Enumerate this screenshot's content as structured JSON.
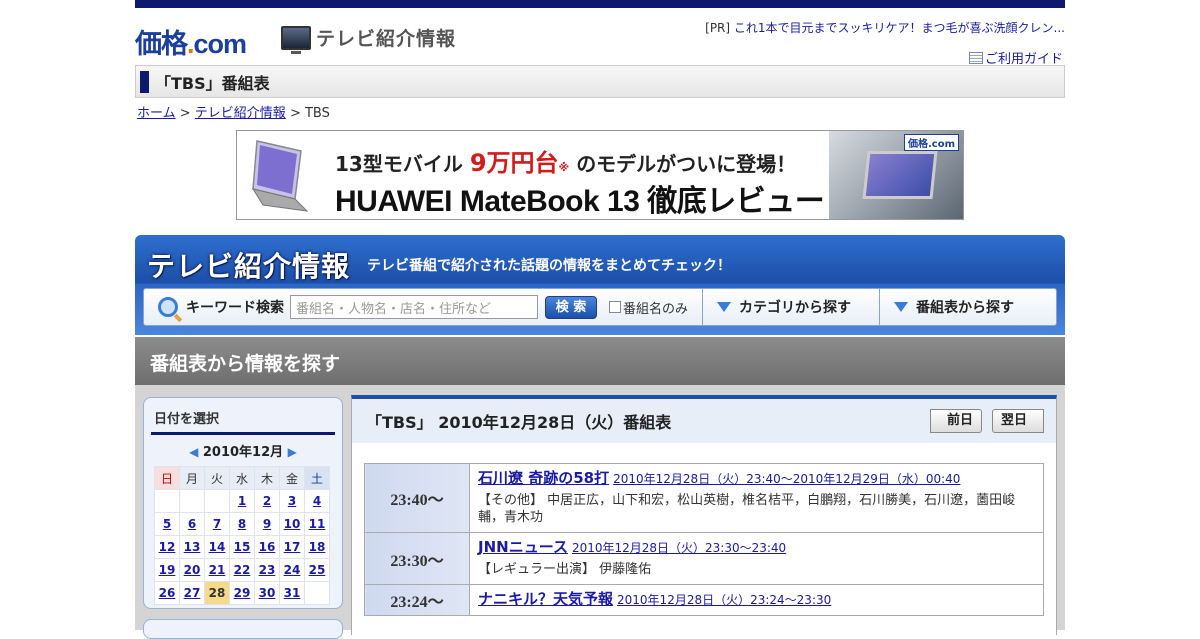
{
  "header": {
    "logo_main": "価格",
    "logo_dot": ".",
    "logo_tld": "com",
    "section_logo": "テレビ紹介情報",
    "pr_tag": "[PR]",
    "pr_text": "これ1本で目元までスッキリケア！まつ毛が喜ぶ洗顔クレン...",
    "guide": "ご利用ガイド"
  },
  "page_title": "「TBS」番組表",
  "breadcrumb": {
    "home": "ホーム",
    "sep1": " > ",
    "tv": "テレビ紹介情報",
    "sep2": " > ",
    "current": "TBS"
  },
  "ad": {
    "line1_a": "13型モバイル",
    "line1_price": "9万円台",
    "line1_mark": "※",
    "line1_b": "のモデルがついに登場！",
    "line2": "HUAWEI MateBook 13 徹底レビュー",
    "badge": "価格.com"
  },
  "search_panel": {
    "title": "テレビ紹介情報",
    "subtitle": "テレビ番組で紹介された話題の情報をまとめてチェック！",
    "keyword_label": "キーワード検索",
    "placeholder": "番組名・人物名・店名・住所など",
    "search_button": "検 索",
    "checkbox_label": "番組名のみ",
    "category_link": "カテゴリから探す",
    "schedule_link": "番組表から探す"
  },
  "section_heading": "番組表から情報を探す",
  "calendar": {
    "heading": "日付を選択",
    "month": "2010年12月",
    "weekdays": [
      "日",
      "月",
      "火",
      "水",
      "木",
      "金",
      "土"
    ],
    "weeks": [
      [
        "",
        "",
        "",
        "1",
        "2",
        "3",
        "4"
      ],
      [
        "5",
        "6",
        "7",
        "8",
        "9",
        "10",
        "11"
      ],
      [
        "12",
        "13",
        "14",
        "15",
        "16",
        "17",
        "18"
      ],
      [
        "19",
        "20",
        "21",
        "22",
        "23",
        "24",
        "25"
      ],
      [
        "26",
        "27",
        "28",
        "29",
        "30",
        "31",
        ""
      ]
    ],
    "selected": "28"
  },
  "schedule": {
    "title": "「TBS」 2010年12月28日（火）番組表",
    "prev": "前日",
    "next": "翌日",
    "programs": [
      {
        "time": "23:40～",
        "title": "石川遼 奇跡の58打",
        "datetime": "2010年12月28日（火）23:40～2010年12月29日（水）00:40",
        "cast_label": "【その他】",
        "cast": "中居正広，山下和宏，松山英樹，椎名桔平，白鵬翔，石川勝美，石川遼，薗田峻輔，青木功"
      },
      {
        "time": "23:30～",
        "title": "JNNニュース",
        "datetime": "2010年12月28日（火）23:30～23:40",
        "cast_label": "【レギュラー出演】",
        "cast": "伊藤隆佑"
      },
      {
        "time": "23:24～",
        "title": "ナニキル？天気予報",
        "datetime": "2010年12月28日（火）23:24～23:30",
        "cast_label": "",
        "cast": ""
      }
    ]
  }
}
